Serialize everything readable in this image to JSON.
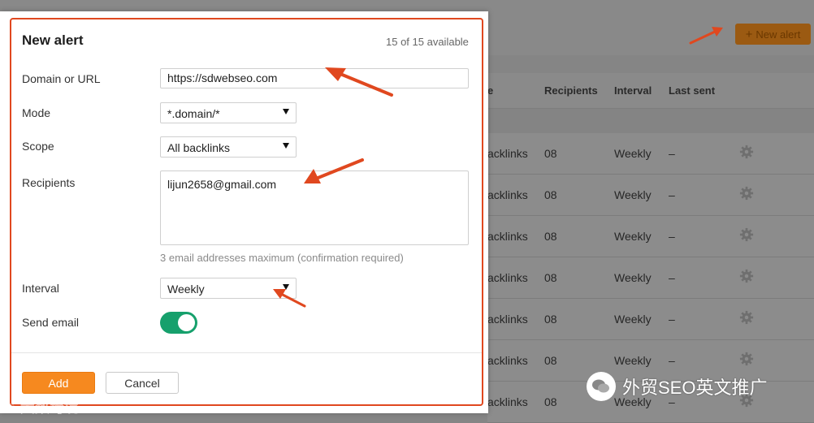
{
  "background": {
    "new_alert_button": "New alert",
    "table": {
      "headers": [
        "e",
        "Recipients",
        "Interval",
        "Last sent"
      ],
      "rows": [
        {
          "scope": "acklinks",
          "recipients": "08",
          "interval": "Weekly",
          "last_sent": "–"
        },
        {
          "scope": "acklinks",
          "recipients": "08",
          "interval": "Weekly",
          "last_sent": "–"
        },
        {
          "scope": "acklinks",
          "recipients": "08",
          "interval": "Weekly",
          "last_sent": "–"
        },
        {
          "scope": "acklinks",
          "recipients": "08",
          "interval": "Weekly",
          "last_sent": "–"
        },
        {
          "scope": "acklinks",
          "recipients": "08",
          "interval": "Weekly",
          "last_sent": "–"
        },
        {
          "scope": "acklinks",
          "recipients": "08",
          "interval": "Weekly",
          "last_sent": "–"
        },
        {
          "scope": "acklinks",
          "recipients": "08",
          "interval": "Weekly",
          "last_sent": "–"
        }
      ]
    }
  },
  "modal": {
    "title": "New alert",
    "availability": "15 of 15 available",
    "domain": {
      "label": "Domain or URL",
      "value": "https://sdwebseo.com"
    },
    "mode": {
      "label": "Mode",
      "value": "*.domain/*"
    },
    "scope": {
      "label": "Scope",
      "value": "All backlinks"
    },
    "recipients": {
      "label": "Recipients",
      "value": "lijun2658@gmail.com",
      "hint": "3 email addresses maximum (confirmation required)"
    },
    "interval": {
      "label": "Interval",
      "value": "Weekly"
    },
    "send_email": {
      "label": "Send email",
      "enabled": true
    },
    "add_label": "Add",
    "cancel_label": "Cancel"
  },
  "watermarks": {
    "left": "大数跨境",
    "right": "外贸SEO英文推广"
  },
  "colors": {
    "accent_orange": "#f6891f",
    "annotation_red": "#e0481f",
    "toggle_green": "#16a06c"
  }
}
